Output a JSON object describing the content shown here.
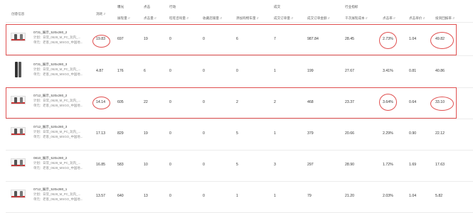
{
  "header": {
    "col_creative": "创意信息",
    "col_cost": "消耗",
    "group_exposure": "曝光",
    "group_click": "点击",
    "group_action": "行动",
    "group_conversion": "成交",
    "group_platform": "行业指标",
    "sub_impressions": "展现量",
    "sub_clicks": "点击量",
    "sub_wangwang": "旺旺咨询量",
    "sub_fav_shop": "收藏店铺量",
    "sub_cart": "添加购物车量",
    "sub_orders": "成交订单量",
    "sub_amount": "成交订单金额",
    "sub_cpm": "千次展现成本",
    "sub_ctr": "点击率",
    "sub_cpc": "点击单价",
    "sub_roi": "投资回报率"
  },
  "rows": [
    {
      "title": "0731_展示_520x280_2",
      "plan": "计划：日常_0628_M_PC_玩内_...",
      "unit": "单元：老客_0628_MSGO_中国地...",
      "cost": "19.83",
      "imp": "697",
      "clk": "19",
      "ww": "0",
      "fav": "0",
      "cart": "6",
      "ord": "7",
      "amt": "987.84",
      "cpm": "28.45",
      "ctr": "2.73%",
      "cpc": "1.04",
      "roi": "49.82"
    },
    {
      "title": "0731_展示_520x280_3",
      "plan": "计划：日常_0628_M_PC_玩内_...",
      "unit": "单元：老客_0628_MSGO_中国地...",
      "cost": "4.87",
      "imp": "176",
      "clk": "6",
      "ww": "0",
      "fav": "0",
      "cart": "0",
      "ord": "1",
      "amt": "199",
      "cpm": "27.67",
      "ctr": "3.41%",
      "cpc": "0.81",
      "roi": "40.86"
    },
    {
      "title": "0712_展示_520x280_2",
      "plan": "计划：日常_0628_M_PC_玩内_...",
      "unit": "单元：老客_0628_MSGO_中国地...",
      "cost": "14.14",
      "imp": "605",
      "clk": "22",
      "ww": "0",
      "fav": "0",
      "cart": "2",
      "ord": "2",
      "amt": "468",
      "cpm": "23.37",
      "ctr": "3.64%",
      "cpc": "0.64",
      "roi": "33.10"
    },
    {
      "title": "0712_展示_520x280_3",
      "plan": "计划：日常_0628_M_PC_玩内_...",
      "unit": "单元：老客_0628_MSGO_中国地...",
      "cost": "17.13",
      "imp": "829",
      "clk": "19",
      "ww": "0",
      "fav": "0",
      "cart": "5",
      "ord": "1",
      "amt": "379",
      "cpm": "20.66",
      "ctr": "2.29%",
      "cpc": "0.90",
      "roi": "22.12"
    },
    {
      "title": "0810_展示_520x280_2",
      "plan": "计划：日常_0628_M_PC_玩内_...",
      "unit": "单元：老客_0628_MSGO_中国地...",
      "cost": "16.85",
      "imp": "583",
      "clk": "10",
      "ww": "0",
      "fav": "0",
      "cart": "5",
      "ord": "3",
      "amt": "297",
      "cpm": "28.90",
      "ctr": "1.72%",
      "cpc": "1.69",
      "roi": "17.63"
    },
    {
      "title": "0712_展示_520x280_1",
      "plan": "计划：日常_0628_M_PC_玩内_...",
      "unit": "单元：老客_0628_MSGO_中国地...",
      "cost": "13.57",
      "imp": "640",
      "clk": "13",
      "ww": "0",
      "fav": "0",
      "cart": "1",
      "ord": "1",
      "amt": "79",
      "cpm": "21.20",
      "ctr": "2.03%",
      "cpc": "1.04",
      "roi": "5.82"
    }
  ],
  "colors": {
    "highlight": "#e05050",
    "line": "#ececec"
  }
}
